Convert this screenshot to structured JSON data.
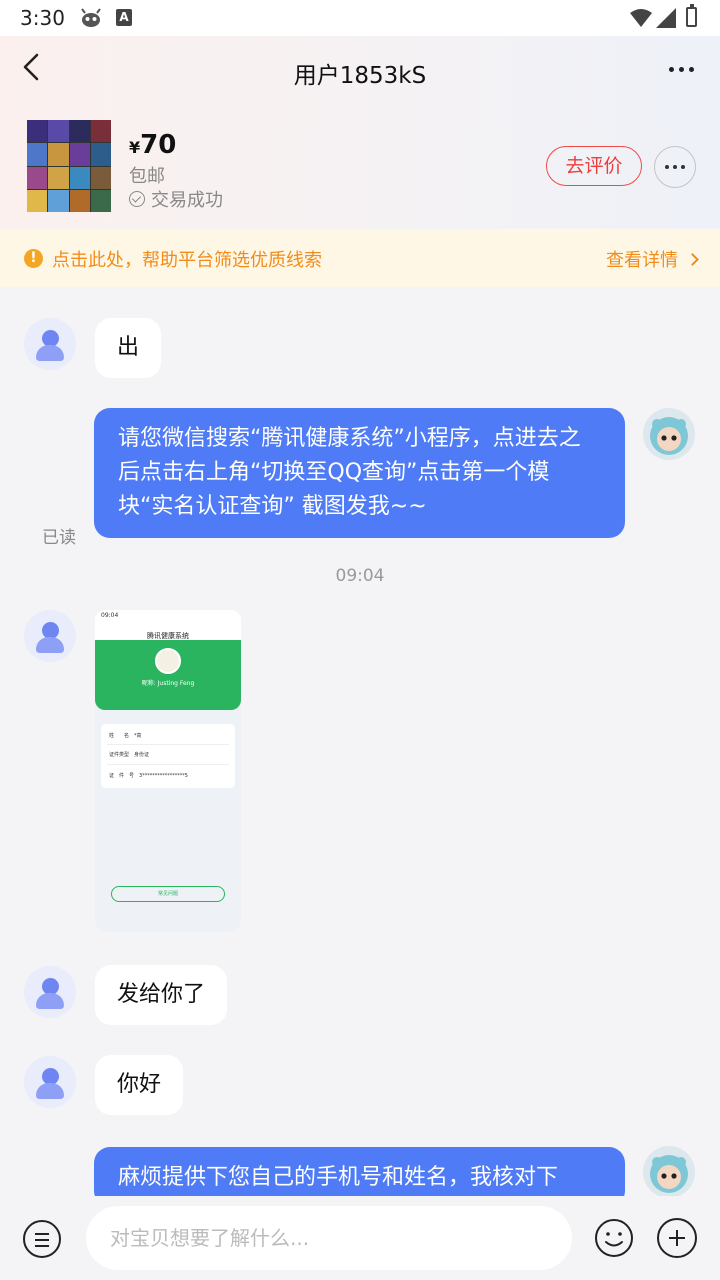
{
  "status_bar": {
    "time": "3:30",
    "a_icon": "A"
  },
  "header": {
    "title": "用户1853kS"
  },
  "product": {
    "currency": "¥",
    "price": "70",
    "shipping": "包邮",
    "trade_status": "交易成功",
    "review_button": "去评价"
  },
  "notice": {
    "icon": "!",
    "text": "点击此处，帮助平台筛选优质线索",
    "link": "查看详情"
  },
  "messages": {
    "m1": "出",
    "m2": "请您微信搜索“腾讯健康系统”小程序，点进去之后点击右上角“切换至QQ查询”点击第一个模块“实名认证查询” 截图发我~~",
    "read": "已读",
    "time": "09:04",
    "m4": "发给你了",
    "m5": "你好",
    "m6": "麻烦提供下您自己的手机号和姓名，我核对下"
  },
  "screenshot": {
    "status_time": "09:04",
    "nav_title": "腾讯健康系统",
    "name": "昵称: Justing Feng",
    "row1_label": "姓　　名",
    "row1_value": "*高",
    "row2_label": "证件类型",
    "row2_value": "身份证",
    "row3_label": "证　件　号",
    "row3_value": "3*****************5",
    "button": "常见问题"
  },
  "input": {
    "placeholder": "对宝贝想要了解什么..."
  },
  "colors": {
    "accent_blue": "#4f7cf6",
    "review_red": "#ee3b3b",
    "notice_orange": "#f08c1a"
  },
  "icons": [
    "bug-icon",
    "a-icon",
    "wifi-icon",
    "signal-icon",
    "battery-icon",
    "back-icon",
    "more-icon",
    "check-circle-icon",
    "notice-icon",
    "chevron-right-icon",
    "user-avatar-icon",
    "menu-icon",
    "emoji-icon",
    "plus-icon"
  ]
}
